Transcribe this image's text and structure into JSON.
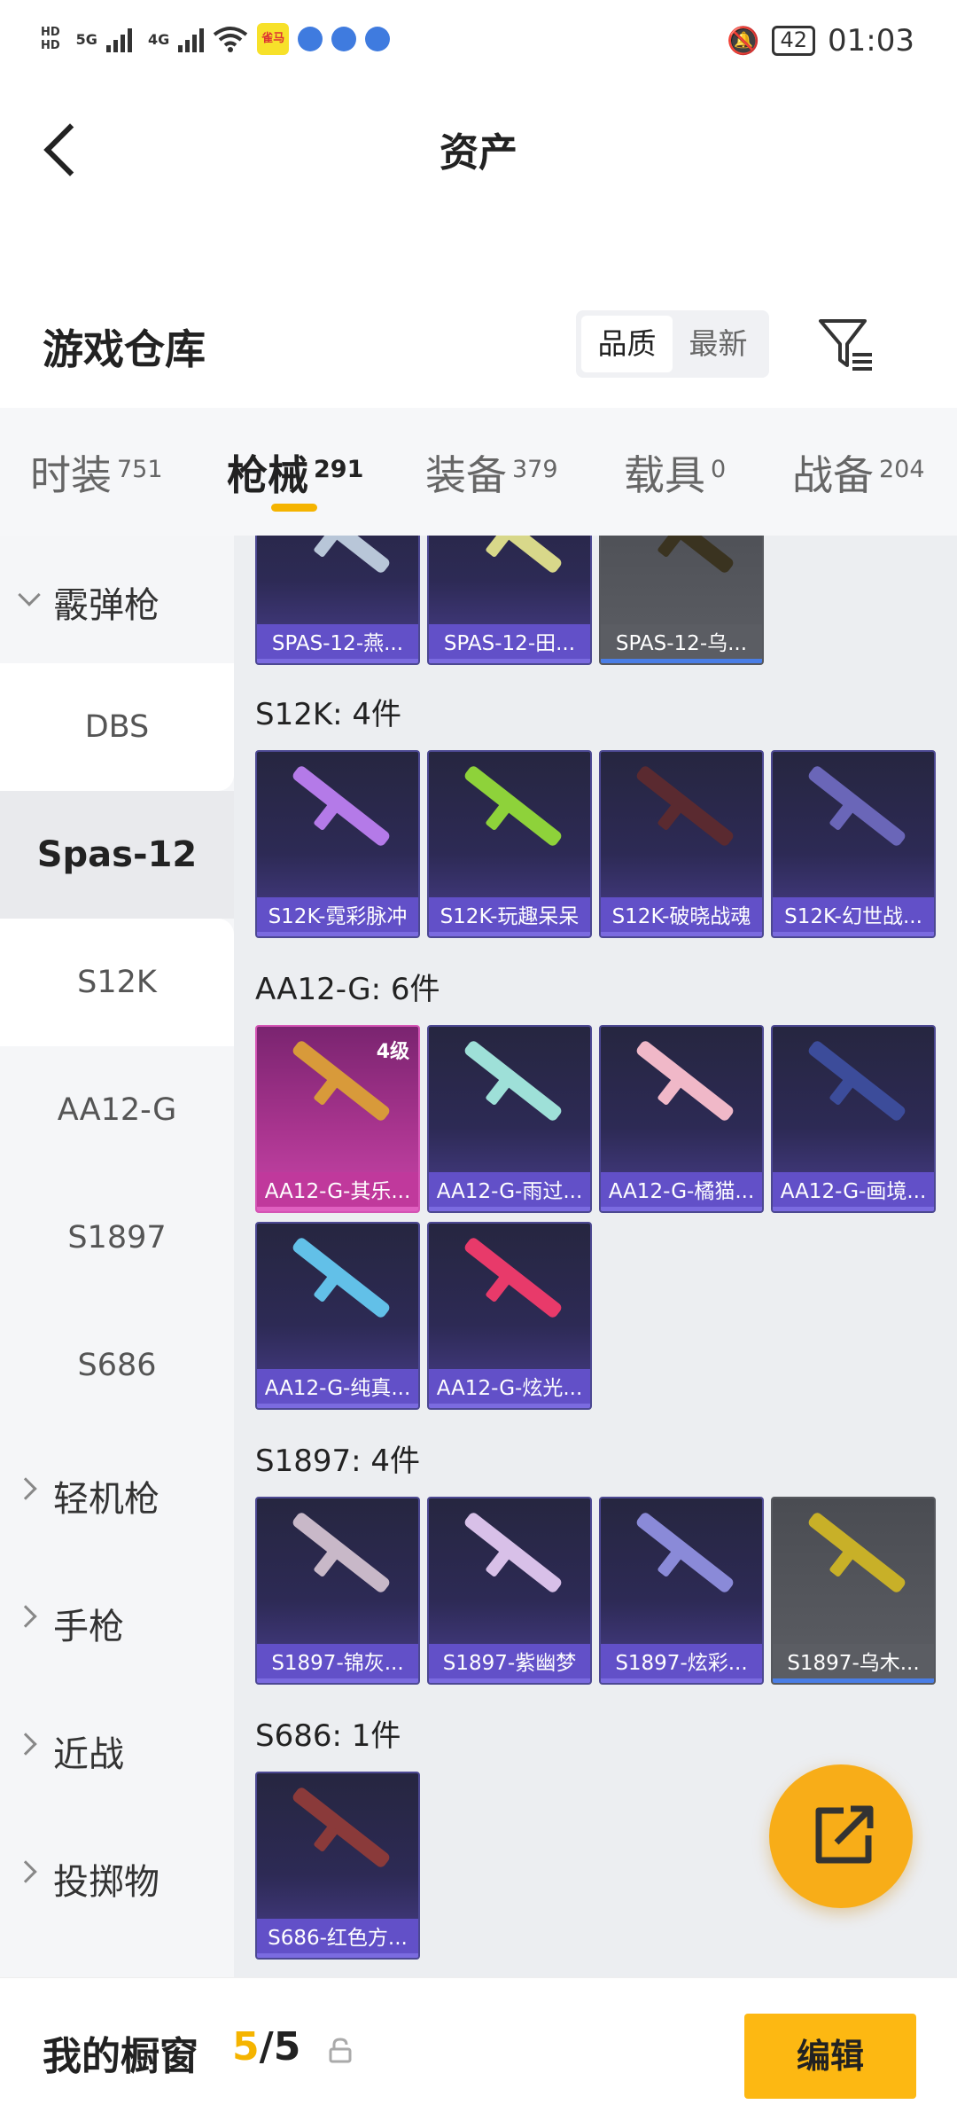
{
  "status_bar": {
    "hd1": "HD",
    "hd2": "HD",
    "net1": "5G",
    "net2": "4G",
    "app_badge": "雀马",
    "battery": "42",
    "time": "01:03"
  },
  "header": {
    "title": "资产"
  },
  "warehouse": {
    "title": "游戏仓库",
    "sort_options": [
      "品质",
      "最新"
    ],
    "sort_selected": "品质"
  },
  "tabs": [
    {
      "label": "时装",
      "count": "751"
    },
    {
      "label": "枪械",
      "count": "291"
    },
    {
      "label": "装备",
      "count": "379"
    },
    {
      "label": "载具",
      "count": "0"
    },
    {
      "label": "战备",
      "count": "204"
    }
  ],
  "sidebar": {
    "category_open": "霰弹枪",
    "subitems": [
      "DBS",
      "Spas-12",
      "S12K",
      "AA12-G",
      "S1897",
      "S686"
    ],
    "selected_sub": "Spas-12",
    "collapsed_categories": [
      "轻机枪",
      "手枪",
      "近战",
      "投掷物"
    ]
  },
  "groups": {
    "spas_items": [
      "SPAS-12-燕...",
      "SPAS-12-田...",
      "SPAS-12-乌..."
    ],
    "s12k": {
      "title": "S12K: 4件",
      "items": [
        "S12K-霓彩脉冲",
        "S12K-玩趣呆呆",
        "S12K-破晓战魂",
        "S12K-幻世战..."
      ]
    },
    "aa12g": {
      "title": "AA12-G: 6件",
      "level_badge": "4级",
      "items": [
        "AA12-G-其乐...",
        "AA12-G-雨过...",
        "AA12-G-橘猫...",
        "AA12-G-画境...",
        "AA12-G-纯真...",
        "AA12-G-炫光..."
      ]
    },
    "s1897": {
      "title": "S1897: 4件",
      "items": [
        "S1897-锦灰...",
        "S1897-紫幽梦",
        "S1897-炫彩...",
        "S1897-乌木..."
      ]
    },
    "s686": {
      "title": "S686: 1件",
      "items": [
        "S686-红色方..."
      ]
    }
  },
  "bottom": {
    "label": "我的橱窗",
    "current": "5",
    "sep": "/",
    "total": "5",
    "edit_button": "编辑"
  },
  "colors": {
    "accent": "#f5b400",
    "card_purple": "#6250c8",
    "card_gray": "#5b5d63",
    "card_pink": "#c0399c"
  }
}
